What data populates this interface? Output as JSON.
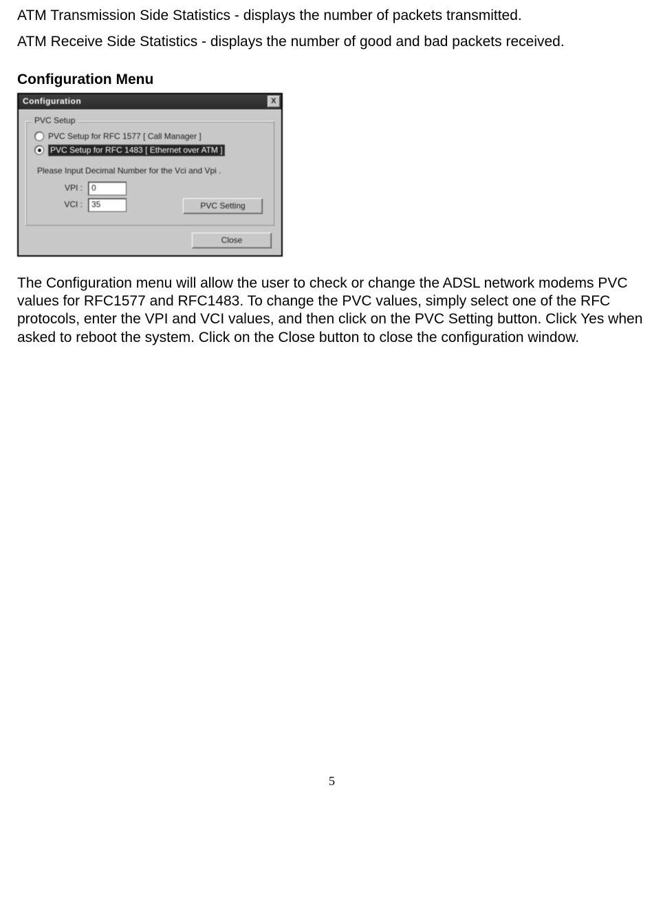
{
  "para1": "ATM Transmission Side Statistics - displays the number of packets transmitted.",
  "para2": "ATM Receive Side Statistics - displays the number of good and bad packets received.",
  "heading": "Configuration Menu",
  "dialog": {
    "title": "Configuration",
    "close": "X",
    "group_caption": "PVC Setup",
    "option1": "PVC Setup for RFC 1577  [ Call Manager ]",
    "option2": "PVC Setup for RFC 1483  [ Ethernet over ATM ]",
    "hint": "Please Input Decimal  Number for the Vci and Vpi .",
    "vpi_label": "VPI :",
    "vci_label": "VCI :",
    "vpi_value": "0",
    "vci_value": "35",
    "pvc_button": "PVC Setting",
    "close_button": "Close"
  },
  "config_desc": "The Configuration menu will allow the user to check or change the ADSL network modems PVC values for RFC1577 and RFC1483.  To change the PVC values, simply select one of the RFC protocols, enter the VPI and VCI values, and then click on the PVC Setting button.  Click Yes when asked to reboot the system.  Click on the Close button to close the configuration window.",
  "page_number": "5"
}
